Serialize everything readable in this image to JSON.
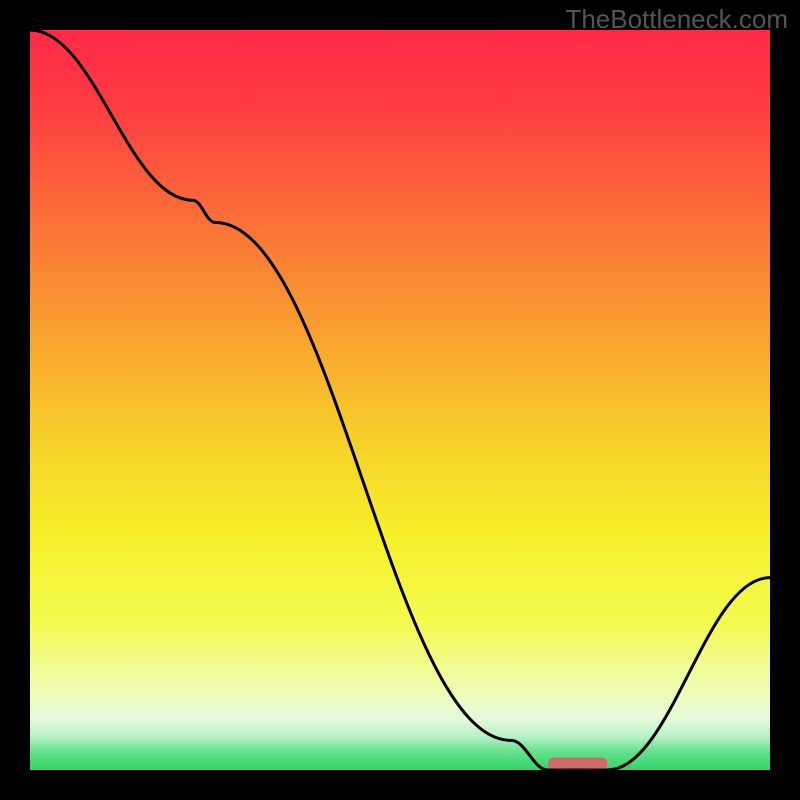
{
  "watermark": "TheBottleneck.com",
  "chart_data": {
    "type": "line",
    "title": "",
    "xlabel": "",
    "ylabel": "",
    "xlim": [
      0,
      100
    ],
    "ylim": [
      0,
      100
    ],
    "series": [
      {
        "name": "bottleneck-curve",
        "x": [
          0,
          22,
          25,
          65,
          70,
          78,
          100
        ],
        "values": [
          100,
          77,
          74,
          4,
          0,
          0,
          26
        ],
        "color": "#000000"
      }
    ],
    "markers": [
      {
        "name": "optimal-range",
        "x_start": 70,
        "x_end": 78,
        "y": 1,
        "color": "#d36a6a"
      }
    ],
    "gradient_stops": [
      {
        "offset": 0.0,
        "color": "#fe2a47"
      },
      {
        "offset": 0.1,
        "color": "#fe3b42"
      },
      {
        "offset": 0.25,
        "color": "#fc6d38"
      },
      {
        "offset": 0.4,
        "color": "#f99e30"
      },
      {
        "offset": 0.55,
        "color": "#f7cf2a"
      },
      {
        "offset": 0.68,
        "color": "#f6ef29"
      },
      {
        "offset": 0.8,
        "color": "#f4fa4e"
      },
      {
        "offset": 0.88,
        "color": "#f1fca7"
      },
      {
        "offset": 0.93,
        "color": "#e6fada"
      },
      {
        "offset": 0.955,
        "color": "#b6f2c5"
      },
      {
        "offset": 0.975,
        "color": "#66e18c"
      },
      {
        "offset": 1.0,
        "color": "#2dd66a"
      }
    ]
  }
}
